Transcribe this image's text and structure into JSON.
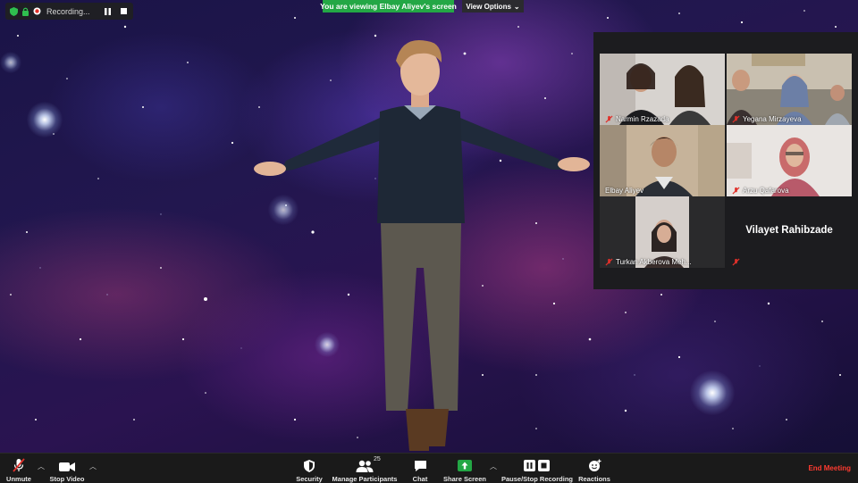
{
  "recording": {
    "label": "Recording..."
  },
  "banner": {
    "viewing_text": "You are viewing Elbay Aliyev's screen"
  },
  "view_options": {
    "label": "View Options"
  },
  "participants": [
    {
      "name": "Narmin Rzazada",
      "muted": true
    },
    {
      "name": "Yegana Mirzayeva",
      "muted": true
    },
    {
      "name": "Elbay Aliyev",
      "muted": false,
      "active": true
    },
    {
      "name": "Arzu Qafarova",
      "muted": true
    },
    {
      "name": "Turkan Akberova Meh...",
      "muted": true
    },
    {
      "name": "Vilayet Rahibzade",
      "muted": true,
      "video_off": true
    }
  ],
  "toolbar": {
    "unmute": "Unmute",
    "stop_video": "Stop Video",
    "security": "Security",
    "manage_participants": "Manage Participants",
    "participant_count": "25",
    "chat": "Chat",
    "share_screen": "Share Screen",
    "pause_stop_recording": "Pause/Stop Recording",
    "reactions": "Reactions",
    "end_meeting": "End Meeting"
  },
  "colors": {
    "banner_green": "#23a745",
    "end_meeting_red": "#ff3b30",
    "active_speaker_yellow": "#e0e33a",
    "mute_red": "#e0302a"
  }
}
